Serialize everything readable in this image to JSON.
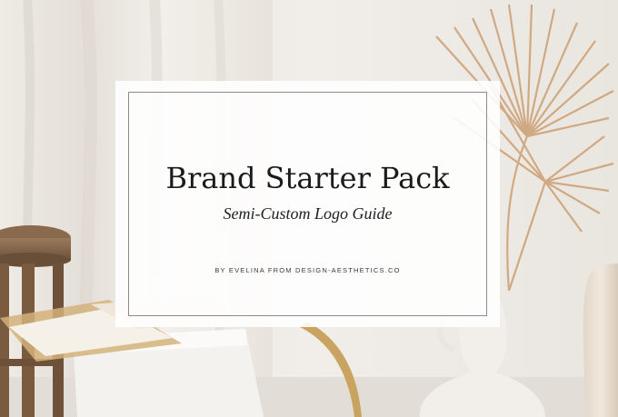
{
  "card": {
    "title": "Brand Starter Pack",
    "subtitle": "Semi-Custom Logo Guide",
    "byline": "BY EVELINA FROM DESIGN-AESTHETICS.CO"
  }
}
